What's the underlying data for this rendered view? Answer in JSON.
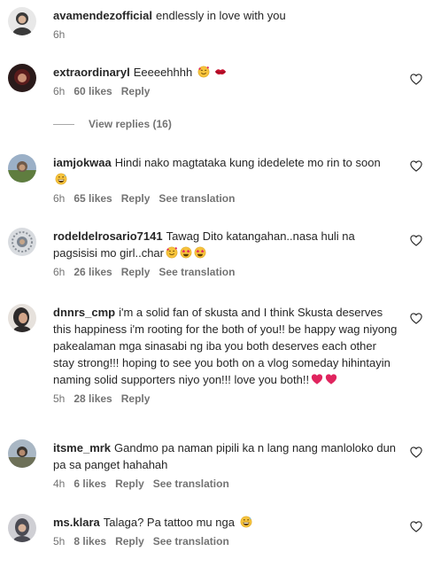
{
  "comments": [
    {
      "user": "avamendezofficial",
      "text": "endlessly in love with you",
      "time": "6h",
      "likes": "",
      "reply": "",
      "translate": "",
      "emojis": [],
      "avatar_color": "#3a3a3a",
      "has_like": false
    },
    {
      "user": "extraordinaryl",
      "text": "Eeeeehhhh",
      "time": "6h",
      "likes": "60 likes",
      "reply": "Reply",
      "translate": "",
      "emojis": [
        "smiling-face-with-hearts",
        "kiss-mark"
      ],
      "avatar_color": "#5a1c1c",
      "has_like": true
    },
    {
      "user": "iamjokwaa",
      "text": "Hindi nako magtataka kung idedelete mo rin to soon",
      "time": "6h",
      "likes": "65 likes",
      "reply": "Reply",
      "translate": "See translation",
      "emojis": [
        "grinning-sweat"
      ],
      "avatar_color": "#6f8a4f",
      "has_like": true
    },
    {
      "user": "rodeldelrosario7141",
      "text": "Tawag Dito katangahan..nasa huli na pagsisisi mo girl..char",
      "time": "6h",
      "likes": "26 likes",
      "reply": "Reply",
      "translate": "See translation",
      "emojis": [
        "smiling-face-with-hearts",
        "star-struck",
        "star-struck"
      ],
      "avatar_color": "#b8bcc2",
      "has_like": true
    },
    {
      "user": "dnnrs_cmp",
      "text": "i'm a solid fan of skusta and I think Skusta deserves this happiness i'm rooting for the both of you!! be happy wag niyong pakealaman mga sinasabi ng iba you both deserves each other stay strong!!! hoping to see you both on a vlog someday hihintayin naming solid supporters niyo yon!!! love you both!!",
      "time": "5h",
      "likes": "28 likes",
      "reply": "Reply",
      "translate": "",
      "emojis": [
        "red-heart",
        "red-heart"
      ],
      "avatar_color": "#2d2a2a",
      "has_like": true
    },
    {
      "user": "itsme_mrk",
      "text": "Gandmo pa naman pipili ka n lang nang manloloko dun pa sa panget hahahah",
      "time": "4h",
      "likes": "6 likes",
      "reply": "Reply",
      "translate": "See translation",
      "emojis": [],
      "avatar_color": "#8a8f7a",
      "has_like": true
    },
    {
      "user": "ms.klara",
      "text": "Talaga? Pa tattoo mu nga",
      "time": "5h",
      "likes": "8 likes",
      "reply": "Reply",
      "translate": "See translation",
      "emojis": [
        "grinning-sweat"
      ],
      "avatar_color": "#4a4a52",
      "has_like": true
    }
  ],
  "view_replies": "View replies (16)",
  "colors": {
    "text": "#262626",
    "secondary": "#737373",
    "heart-red": "#e0245e",
    "emoji-yellow": "#f7c33c"
  }
}
